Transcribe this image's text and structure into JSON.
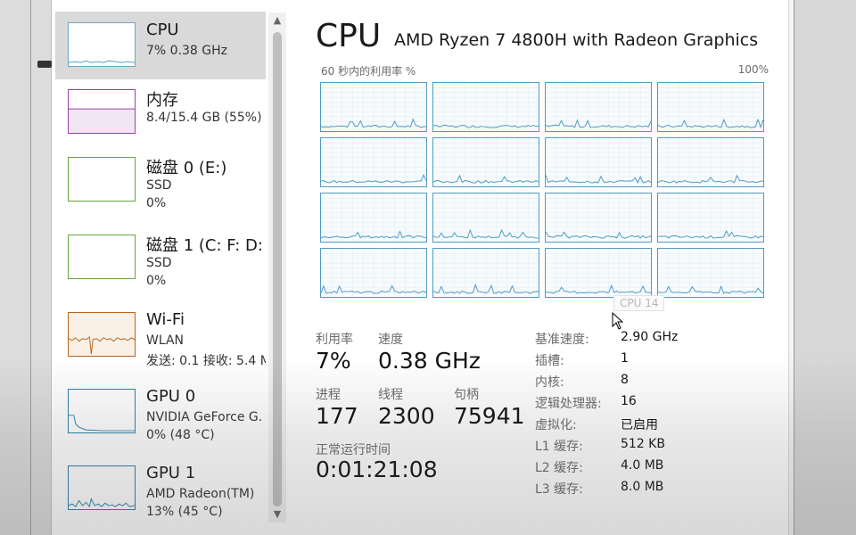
{
  "sidebar": {
    "items": [
      {
        "title": "CPU",
        "sub1": "7%  0.38 GHz",
        "sub2": "",
        "sub3": "",
        "graph_color": "#4f9bc2"
      },
      {
        "title": "内存",
        "sub1": "8.4/15.4 GB (55%)",
        "sub2": "",
        "sub3": "",
        "graph_color": "#9b3fa8"
      },
      {
        "title": "磁盘 0 (E:)",
        "sub1": "SSD",
        "sub2": "0%",
        "sub3": "",
        "graph_color": "#6aa53e"
      },
      {
        "title": "磁盘 1 (C: F: D:",
        "sub1": "SSD",
        "sub2": "0%",
        "sub3": "",
        "graph_color": "#6aa53e"
      },
      {
        "title": "Wi-Fi",
        "sub1": "WLAN",
        "sub2": "发送: 0.1  接收: 5.4 M",
        "sub3": "",
        "graph_color": "#b5651d"
      },
      {
        "title": "GPU 0",
        "sub1": "NVIDIA GeForce G.",
        "sub2": "0% (48 °C)",
        "sub3": "",
        "graph_color": "#2e7fa8"
      },
      {
        "title": "GPU 1",
        "sub1": "AMD Radeon(TM)",
        "sub2": "13% (45 °C)",
        "sub3": "",
        "graph_color": "#2e7fa8"
      }
    ]
  },
  "header": {
    "title": "CPU",
    "model": "AMD Ryzen 7 4800H with Radeon Graphics",
    "util_caption": "60 秒内的利用率 %",
    "max_caption": "100%"
  },
  "tooltip": "CPU 14",
  "stats": {
    "util_label": "利用率",
    "util_value": "7%",
    "speed_label": "速度",
    "speed_value": "0.38 GHz",
    "proc_label": "进程",
    "proc_value": "177",
    "thread_label": "线程",
    "thread_value": "2300",
    "handle_label": "句柄",
    "handle_value": "75941",
    "uptime_label": "正常运行时间",
    "uptime_value": "0:01:21:08"
  },
  "specs": [
    {
      "k": "基准速度:",
      "v": "2.90 GHz"
    },
    {
      "k": "插槽:",
      "v": "1"
    },
    {
      "k": "内核:",
      "v": "8"
    },
    {
      "k": "逻辑处理器:",
      "v": "16"
    },
    {
      "k": "虚拟化:",
      "v": "已启用"
    },
    {
      "k": "L1 缓存:",
      "v": "512 KB"
    },
    {
      "k": "L2 缓存:",
      "v": "4.0 MB"
    },
    {
      "k": "L3 缓存:",
      "v": "8.0 MB"
    }
  ],
  "colors": {
    "accent": "#4f9bc2",
    "selected_bg": "#d9d9d9"
  }
}
